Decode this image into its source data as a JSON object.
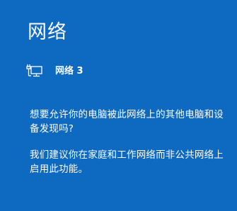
{
  "panel": {
    "title": "网络",
    "network": {
      "icon": "network-wired-icon",
      "name": "网络 3"
    },
    "question": "想要允许你的电脑被此网络上的其他电脑和设备发现吗?",
    "recommendation": "我们建议你在家庭和工作网络而非公共网络上启用此功能。"
  },
  "colors": {
    "background": "#0e69c0",
    "text": "#ffffff"
  }
}
